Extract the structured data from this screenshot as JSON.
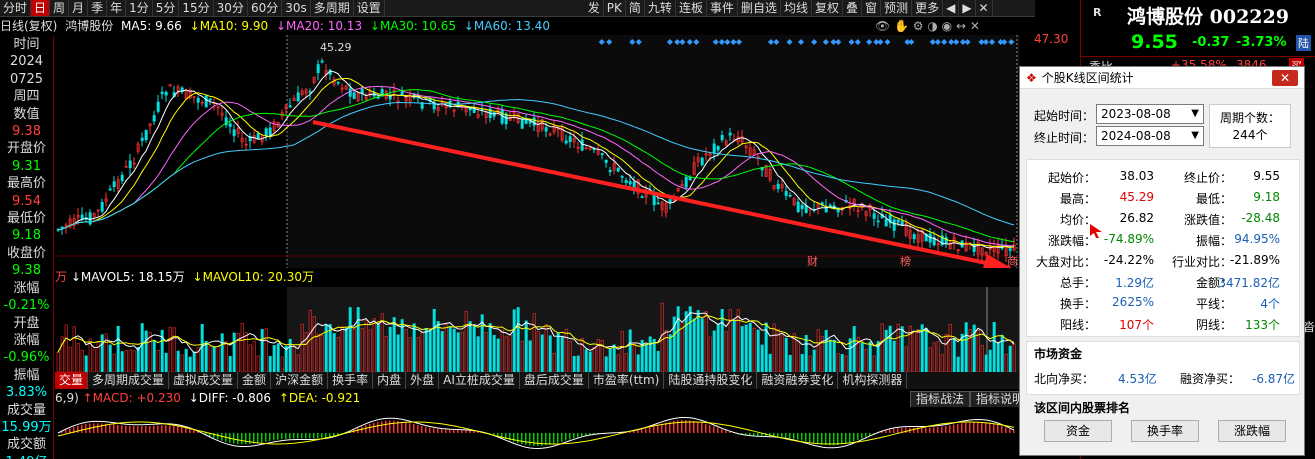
{
  "toolbar": {
    "left_items": [
      "分时",
      "日",
      "周",
      "月",
      "季",
      "年",
      "1分",
      "5分",
      "15分",
      "30分",
      "60分",
      "30s",
      "多周期",
      "设置"
    ],
    "active_index": 1,
    "right_items": [
      "发",
      "PK",
      "简",
      "九转",
      "连板",
      "事件",
      "删自选",
      "均线",
      "复权",
      "叠",
      "窗",
      "预测",
      "更多"
    ],
    "nav_buttons": [
      "◀",
      "▶",
      "✕"
    ]
  },
  "info": {
    "title": "日线(复权)",
    "name": "鸿博股份",
    "ma5": "MA5: 9.66",
    "ma10": "MA10: 9.90",
    "ma20": "MA20: 10.13",
    "ma30": "MA30: 10.65",
    "ma60": "MA60: 13.40",
    "top_price": "47.30",
    "peak_label": "45.29"
  },
  "left_panel": [
    {
      "text": "时间",
      "color": "#dddddd"
    },
    {
      "text": "2024",
      "color": "#dddddd"
    },
    {
      "text": "0725",
      "color": "#dddddd"
    },
    {
      "text": "周四",
      "color": "#dddddd"
    },
    {
      "text": "数值",
      "color": "#dddddd"
    },
    {
      "text": "9.38",
      "color": "#ff4040"
    },
    {
      "text": "开盘价",
      "color": "#dddddd"
    },
    {
      "text": "9.31",
      "color": "#00ff00"
    },
    {
      "text": "最高价",
      "color": "#dddddd"
    },
    {
      "text": "9.54",
      "color": "#ff4040"
    },
    {
      "text": "最低价",
      "color": "#dddddd"
    },
    {
      "text": "9.18",
      "color": "#00ff00"
    },
    {
      "text": "收盘价",
      "color": "#dddddd"
    },
    {
      "text": "9.38",
      "color": "#00ff00"
    },
    {
      "text": "涨幅",
      "color": "#dddddd"
    },
    {
      "text": "-0.21%",
      "color": "#00ff00"
    },
    {
      "text": "开盘",
      "color": "#dddddd"
    },
    {
      "text": "涨幅",
      "color": "#dddddd"
    },
    {
      "text": "-0.96%",
      "color": "#00ff00"
    },
    {
      "text": "振幅",
      "color": "#dddddd"
    },
    {
      "text": "3.83%",
      "color": "#00ffff"
    },
    {
      "text": "成交量",
      "color": "#dddddd"
    },
    {
      "text": "15.99万",
      "color": "#00ffff"
    },
    {
      "text": "成交额",
      "color": "#dddddd"
    },
    {
      "text": "1.49亿",
      "color": "#00ffff"
    }
  ],
  "volume": {
    "prefix": "万",
    "mavol5": "MAVOL5: 18.15万",
    "mavol10": "MAVOL10: 20.30万"
  },
  "tabs": [
    "交量",
    "多周期成交量",
    "虚拟成交量",
    "金额",
    "沪深金额",
    "换手率",
    "内盘",
    "外盘",
    "AI立桩成交量",
    "盘后成交量",
    "市盈率(ttm)",
    "陆股通持股变化",
    "融资融券变化",
    "机构探测器"
  ],
  "macd": {
    "prefix": "6,9)",
    "macd": "MACD: +0.230",
    "diff": "DIFF: -0.806",
    "dea": "DEA: -0.921",
    "btn1": "指标战法",
    "btn2": "指标说明"
  },
  "markers": {
    "m1": "财",
    "m2": "榜",
    "m3": "商"
  },
  "quote": {
    "logo": "R",
    "name": "鸿博股份",
    "code": "002229",
    "price": "9.55",
    "change": "-0.37",
    "pct": "-3.73%",
    "market": "陆",
    "row_label": "委比",
    "row_pct": "+35.58%",
    "row_num": "3846",
    "row_flag": "买"
  },
  "dialog": {
    "title": "个股K线区间统计",
    "close": "✕",
    "start_label": "起始时间：",
    "start_value": "2023-08-08",
    "end_label": "终止时间：",
    "end_value": "2024-08-08",
    "period_label": "周期个数：",
    "period_value": "244个",
    "stats": {
      "start_price_label": "起始价：",
      "start_price": "38.03",
      "end_price_label": "终止价：",
      "end_price": "9.55",
      "high_label": "最高：",
      "high": "45.29",
      "low_label": "最低：",
      "low": "9.18",
      "avg_label": "均价：",
      "avg": "26.82",
      "chg_label": "涨跌值：",
      "chg": "-28.48",
      "pct_label": "涨跌幅：",
      "pct": "-74.89%",
      "amp_label": "振幅：",
      "amp": "94.95%",
      "mkt_label": "大盘对比：",
      "mkt": "-24.22%",
      "ind_label": "行业对比：",
      "ind": "-21.89%",
      "vol_label": "总手：",
      "vol": "1.29亿",
      "amt_label": "金额：",
      "amt": "3471.82亿",
      "turn_label": "换手：",
      "turn": "2625%",
      "flat_label": "平线：",
      "flat": "4个",
      "yang_label": "阳线：",
      "yang": "107个",
      "yin_label": "阴线：",
      "yin": "133个"
    },
    "fund_title": "市场资金",
    "north_label": "北向净买：",
    "north": "4.53亿",
    "margin_label": "融资净买：",
    "margin": "-6.87亿",
    "rank_title": "该区间内股票排名",
    "btn_fund": "资金",
    "btn_turn": "换手率",
    "btn_pct": "涨跌幅"
  },
  "colors": {
    "up": "#ff3030",
    "down": "#00e0e0",
    "ma5": "#ffffff",
    "ma10": "#ffff00",
    "ma20": "#ff66ff",
    "ma30": "#00ff00",
    "ma60": "#44ccff",
    "arrow": "#ff2020"
  }
}
